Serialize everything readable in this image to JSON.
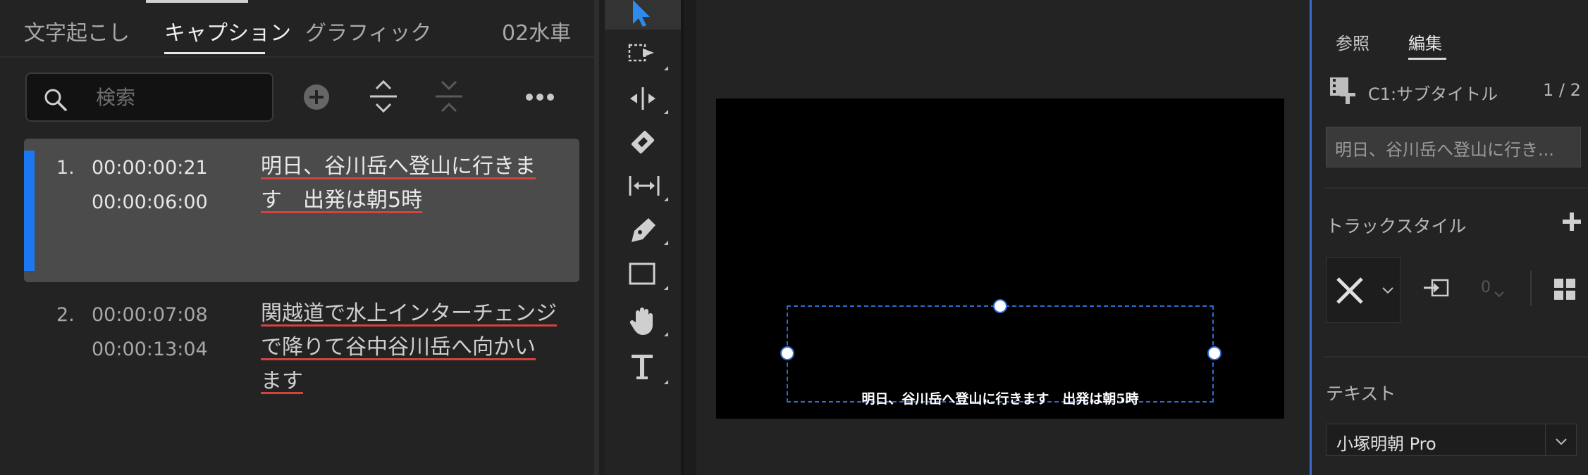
{
  "captions_panel": {
    "tabs": [
      {
        "label": "文字起こし",
        "active": false
      },
      {
        "label": "キャプション",
        "active": true
      },
      {
        "label": "グラフィック",
        "active": false
      }
    ],
    "sequence_name": "02水車",
    "search": {
      "placeholder": "検索"
    },
    "toolbar_icons": [
      "add-icon",
      "split-icon",
      "merge-icon",
      "more-icon"
    ],
    "captions": [
      {
        "number": "1.",
        "in": "00:00:00:21",
        "out": "00:00:06:00",
        "lines": [
          "明日、谷川岳へ登山に行きま",
          "す　出発は朝5時"
        ],
        "selected": true
      },
      {
        "number": "2.",
        "in": "00:00:07:08",
        "out": "00:00:13:04",
        "lines": [
          "関越道で水上インターチェンジ",
          "で降りて谷中谷川岳へ向かい",
          "ます"
        ],
        "selected": false
      }
    ]
  },
  "tools": [
    "selection-tool",
    "track-select-tool",
    "ripple-edit-tool",
    "razor-tool",
    "slip-tool",
    "pen-tool",
    "rectangle-tool",
    "hand-tool",
    "type-tool"
  ],
  "monitor": {
    "subtitle": "明日、谷川岳へ登山に行きます　出発は朝5時"
  },
  "properties": {
    "tabs": [
      {
        "label": "参照",
        "active": false
      },
      {
        "label": "編集",
        "active": true
      }
    ],
    "track_title": "C1:サブタイトル",
    "track_count": "1 / 2",
    "caption_preview": "明日、谷川岳へ登山に行き...",
    "track_style_label": "トラックスタイル",
    "style_value": "0",
    "text_label": "テキスト",
    "font": "小塚明朝 Pro"
  },
  "colors": {
    "accent": "#1b78f2",
    "underline": "#d1453b",
    "selection_row": "#4b4b4b"
  }
}
